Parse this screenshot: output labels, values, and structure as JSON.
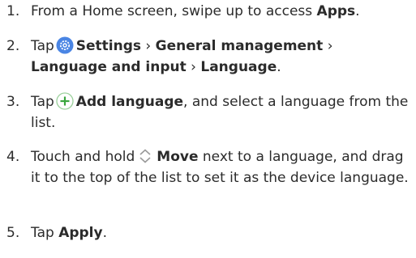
{
  "steps": [
    {
      "number": "1.",
      "parts": [
        "From a Home screen, swipe up to access ",
        "Apps",
        "."
      ]
    },
    {
      "number": "2.",
      "parts": [
        "Tap",
        "Settings",
        " › ",
        "General management",
        " ›",
        "Language and input",
        " › ",
        "Language",
        "."
      ],
      "icon": "settings-gear-icon",
      "icon_color": "#3f7fe0"
    },
    {
      "number": "3.",
      "parts": [
        "Tap",
        "Add language",
        ", and select a language from the list."
      ],
      "icon": "add-circle-icon",
      "icon_color": "#4caf50"
    },
    {
      "number": "4.",
      "parts": [
        "Touch and hold",
        "Move",
        " next to a language, and drag it to the top of the list to set it as the device language."
      ],
      "icon": "move-chevron-icon",
      "icon_color": "#9a9a9a"
    },
    {
      "number": "5.",
      "parts": [
        "Tap ",
        "Apply",
        "."
      ]
    }
  ]
}
